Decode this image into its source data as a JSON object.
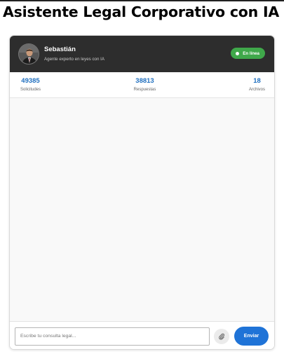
{
  "page": {
    "title": "Asistente Legal Corporativo con IA"
  },
  "chat": {
    "agent_name": "Sebastián",
    "agent_role": "Agente experto en leyes con IA",
    "status": "En línea",
    "avatar_icon": "lawyer-avatar",
    "colors": {
      "header_bg": "#2d2d2d",
      "status_green": "#3fa84a",
      "accent_blue": "#1f73d7",
      "stat_blue": "#1f6fbf"
    }
  },
  "stats": [
    {
      "value": "49385",
      "label": "Solicitudes"
    },
    {
      "value": "38813",
      "label": "Respuestas"
    },
    {
      "value": "18",
      "label": "Archivos"
    }
  ],
  "composer": {
    "placeholder": "Escribe tu consulta legal...",
    "attach_icon": "paperclip-icon",
    "send_label": "Enviar"
  }
}
